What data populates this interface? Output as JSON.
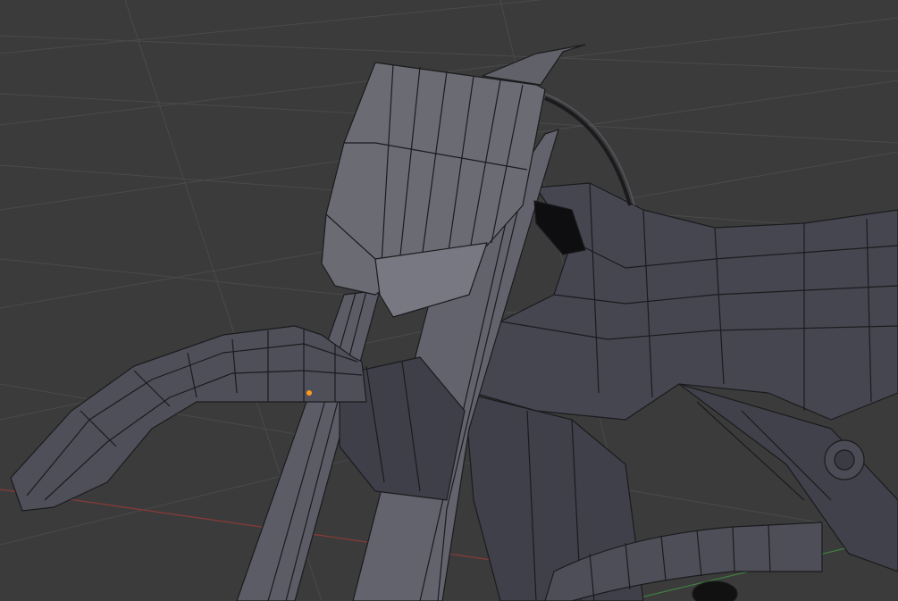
{
  "viewport": {
    "background_color": "#3b3b3b",
    "grid_color": "#4a4a4a",
    "x_axis_color": "#8a3a3a",
    "y_axis_color": "#3f7f3f",
    "mesh_face_color": "#4a4b55",
    "mesh_wire_color": "#1b1b1e",
    "selected_vertex_color": "#ff9a1f"
  }
}
